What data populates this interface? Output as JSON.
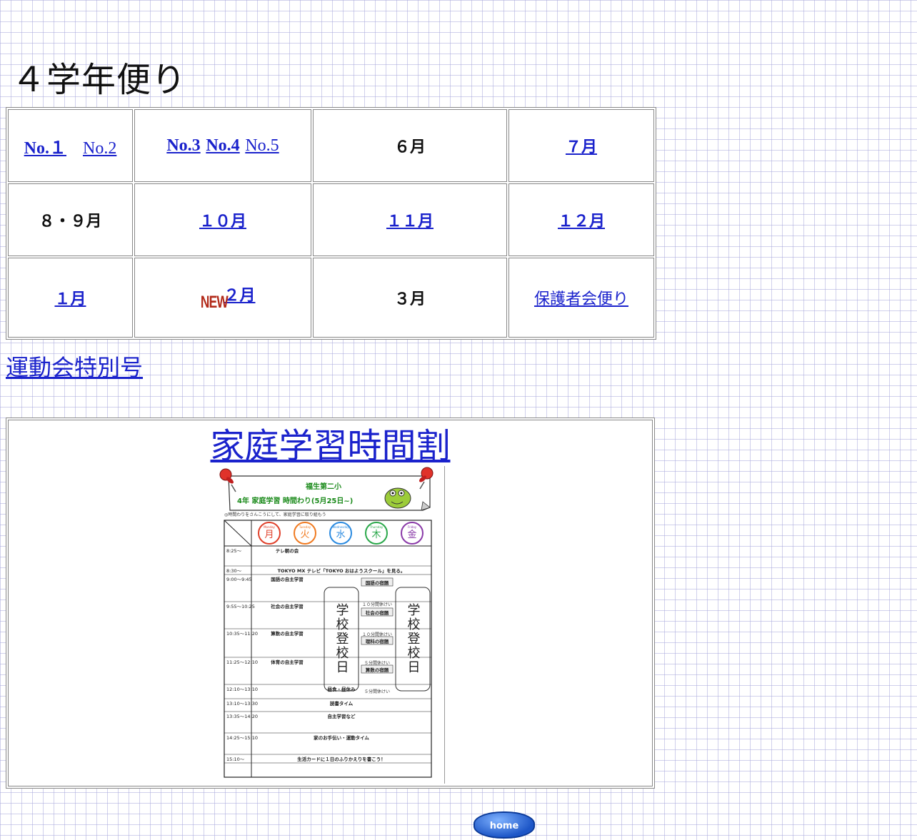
{
  "page_title": "４学年便り",
  "grid": {
    "row1": {
      "c1": [
        "No.１",
        "No.2"
      ],
      "c2": [
        "No.3",
        "No.4",
        "No.5"
      ],
      "c3": "６月",
      "c4": "７月"
    },
    "row2": {
      "c1": "８・９月",
      "c2": "１０月",
      "c3": "１１月",
      "c4": "１２月"
    },
    "row3": {
      "c1": "１月",
      "c2_badge": "NEW",
      "c2": "２月",
      "c3": "３月",
      "c4": "保護者会便り"
    }
  },
  "sports_link": "運動会特別号",
  "study_section": {
    "title": "家庭学習時間割",
    "sheet": {
      "school": "福生第二小",
      "heading": "4年 家庭学習 時間わり(5月25日~)",
      "intro": "◎時間わりをさんこうにして、家庭学習に取り組もう",
      "days": [
        "月",
        "火",
        "水",
        "木",
        "金"
      ],
      "day_en": [
        "Monday",
        "Tuesday",
        "Wednesday",
        "Thursday",
        "Friday"
      ],
      "school_day": "学校登校日",
      "rows": [
        {
          "time": "8:25〜",
          "text": "テレ朝の会"
        },
        {
          "time": "8:30〜",
          "text": "TOKYO MX テレビ「TOKYO おはようスクール」を見る。"
        },
        {
          "time": "9:00〜9:45",
          "text": "国語の自主学習"
        },
        {
          "time": "9:55〜10:25",
          "text": "社会の自主学習"
        },
        {
          "time": "10:35〜11:20",
          "text": "算数の自主学習"
        },
        {
          "time": "11:25〜12:10",
          "text": "体育の自主学習"
        },
        {
          "time": "12:10〜13:10",
          "text": "昼食・昼休み"
        },
        {
          "time": "13:10〜13:30",
          "text": "読書タイム"
        },
        {
          "time": "13:35〜14:20",
          "text": "自主学習など"
        },
        {
          "time": "14:25〜15:10",
          "text": "家のお手伝い・運動タイム"
        },
        {
          "time": "15:10〜",
          "text": "生活カードに１日のふりかえりを書こう！"
        }
      ],
      "homework_labels": [
        "国語の宿題",
        "社会の宿題",
        "理科の宿題",
        "算数の宿題"
      ],
      "break_labels": [
        "１０分間休けい",
        "１０分間休けい",
        "５分間休けい",
        "５分間休けい"
      ]
    }
  },
  "home_button": "home",
  "colors": {
    "link": "#1a22cc",
    "new_badge": "#b22a1a",
    "grid_line": "#aaaadc"
  }
}
